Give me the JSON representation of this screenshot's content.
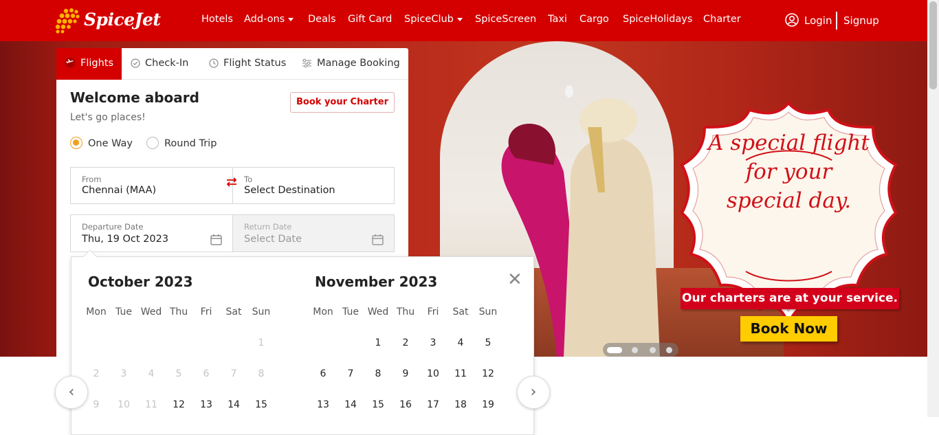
{
  "brand": {
    "name": "SpiceJet",
    "color": "#d40000"
  },
  "nav": {
    "items": [
      {
        "label": "Hotels",
        "dropdown": false
      },
      {
        "label": "Add-ons",
        "dropdown": true
      },
      {
        "label": "Deals",
        "dropdown": false
      },
      {
        "label": "Gift Card",
        "dropdown": false
      },
      {
        "label": "SpiceClub",
        "dropdown": true
      },
      {
        "label": "SpiceScreen",
        "dropdown": false
      },
      {
        "label": "Taxi",
        "dropdown": false
      },
      {
        "label": "Cargo",
        "dropdown": false
      },
      {
        "label": "SpiceHolidays",
        "dropdown": false
      },
      {
        "label": "Charter",
        "dropdown": false
      }
    ],
    "login": "Login",
    "signup": "Signup"
  },
  "booking": {
    "tabs": [
      "Flights",
      "Check-In",
      "Flight Status",
      "Manage Booking"
    ],
    "active_tab": "Flights",
    "welcome": "Welcome aboard",
    "subtitle": "Let's go places!",
    "charter_button": "Book your Charter",
    "trip_types": [
      "One Way",
      "Round Trip"
    ],
    "selected_trip": "One Way",
    "from": {
      "label": "From",
      "value": "Chennai (MAA)"
    },
    "to": {
      "label": "To",
      "placeholder": "Select Destination"
    },
    "departure": {
      "label": "Departure Date",
      "value": "Thu, 19 Oct 2023"
    },
    "return": {
      "label": "Return Date",
      "placeholder": "Select Date"
    }
  },
  "calendar": {
    "weekdays": [
      "Mon",
      "Tue",
      "Wed",
      "Thu",
      "Fri",
      "Sat",
      "Sun"
    ],
    "months": [
      {
        "title": "October 2023",
        "weeks": [
          [
            null,
            null,
            null,
            null,
            null,
            null,
            "1"
          ],
          [
            "2",
            "3",
            "4",
            "5",
            "6",
            "7",
            "8"
          ],
          [
            "9",
            "10",
            "11",
            "12",
            "13",
            "14",
            "15"
          ]
        ],
        "disabled_before": 12
      },
      {
        "title": "November 2023",
        "weeks": [
          [
            null,
            null,
            "1",
            "2",
            "3",
            "4",
            "5"
          ],
          [
            "6",
            "7",
            "8",
            "9",
            "10",
            "11",
            "12"
          ],
          [
            "13",
            "14",
            "15",
            "16",
            "17",
            "18",
            "19"
          ]
        ],
        "disabled_before": 0
      }
    ]
  },
  "promo": {
    "headline_lines": [
      "A special flight",
      "for your",
      "special day."
    ],
    "tagline": "Our charters are at your service.",
    "cta": "Book Now",
    "slides": 4,
    "active_slide": 1
  }
}
